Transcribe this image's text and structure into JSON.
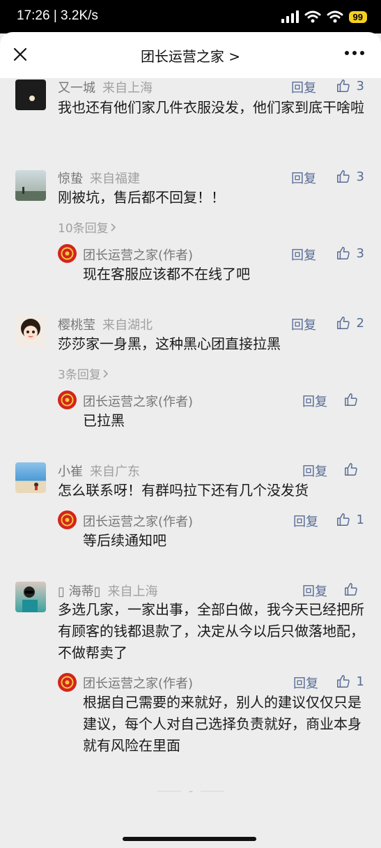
{
  "status_bar": {
    "time": "17:26 | 3.2K/s",
    "battery": "99"
  },
  "header": {
    "title": "团长运营之家 >"
  },
  "colors": {
    "link": "#576b95",
    "background": "#ededed",
    "author_avatar": "#d4241c"
  },
  "comments": [
    {
      "author": "又一城",
      "location": "来自上海",
      "reply_label": "回复",
      "likes": "3",
      "text": "我也还有他们家几件衣服没发，他们家到底干啥啦"
    },
    {
      "author": "惊蛰",
      "location": "来自福建",
      "reply_label": "回复",
      "likes": "3",
      "text": "刚被坑，售后都不回复！！",
      "more_replies": "10条回复",
      "reply": {
        "author": "团长运营之家(作者)",
        "reply_label": "回复",
        "likes": "3",
        "text": "现在客服应该都不在线了吧"
      }
    },
    {
      "author": "樱桃莹",
      "location": "来自湖北",
      "reply_label": "回复",
      "likes": "2",
      "text": "莎莎家一身黑，这种黑心团直接拉黑",
      "more_replies": "3条回复",
      "reply": {
        "author": "团长运营之家(作者)",
        "reply_label": "回复",
        "likes": "",
        "text": "已拉黑"
      }
    },
    {
      "author": "小崔",
      "location": "来自广东",
      "reply_label": "回复",
      "likes": "",
      "text": "怎么联系呀！有群吗拉下还有几个没发货",
      "reply": {
        "author": "团长运营之家(作者)",
        "reply_label": "回复",
        "likes": "1",
        "text": "等后续通知吧"
      }
    },
    {
      "author": "▯ 海蒂▯",
      "location": "来自上海",
      "reply_label": "回复",
      "likes": "",
      "text": "多选几家，一家出事，全部白做，我今天已经把所有顾客的钱都退款了，决定从今以后只做落地配，不做帮卖了",
      "reply": {
        "author": "团长运营之家(作者)",
        "reply_label": "回复",
        "likes": "1",
        "text": "根据自己需要的来就好，别人的建议仅仅只是建议，每个人对自己选择负责就好，商业本身就有风险在里面"
      }
    }
  ]
}
